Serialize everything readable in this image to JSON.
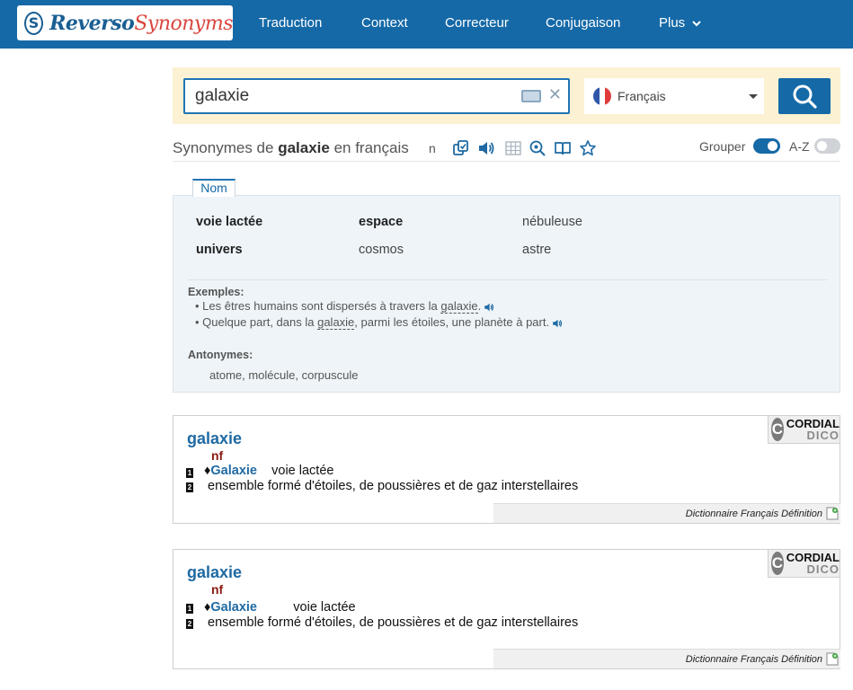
{
  "logo": {
    "badge": "S",
    "part1": "Reverso",
    "part2": "Synonyms"
  },
  "nav": [
    "Traduction",
    "Context",
    "Correcteur",
    "Conjugaison",
    "Plus"
  ],
  "search": {
    "value": "galaxie",
    "language": "Français"
  },
  "heading": {
    "prefix": "Synonymes de ",
    "word": "galaxie",
    "suffix": " en français",
    "n": "n"
  },
  "toolbar": {
    "grouper_label": "Grouper",
    "az_label": "A-Z",
    "grouper_on": true,
    "az_on": false
  },
  "nom": {
    "tab": "Nom",
    "synonyms": [
      [
        "voie lactée",
        "espace",
        "nébuleuse"
      ],
      [
        "univers",
        "cosmos",
        "astre"
      ]
    ],
    "examples_label": "Exemples:",
    "example1": {
      "before": "Les êtres humains sont dispersés à travers la ",
      "word": "galaxie",
      "after": "."
    },
    "example2": {
      "before": "Quelque part, dans la ",
      "word": "galaxie",
      "after": ", parmi les étoiles, une planète à part."
    },
    "antonyms_label": "Antonymes:",
    "antonyms": "atome, molécule, corpuscule"
  },
  "cards": [
    {
      "word": "galaxie",
      "pos": "nf",
      "def1_word": "Galaxie",
      "def1_text": "voie lactée",
      "def2": "ensemble formé d'étoiles, de poussières et de gaz interstellaires",
      "source": "Dictionnaire Français Définition",
      "logo_top": "CORDIAL",
      "logo_bottom": "DICO"
    },
    {
      "word": "galaxie",
      "pos": "nf",
      "def1_word": "Galaxie",
      "def1_text": "voie lactée",
      "def2": "ensemble formé d'étoiles, de poussières et de gaz interstellaires",
      "source": "Dictionnaire Français Définition",
      "logo_top": "CORDIAL",
      "logo_bottom": "DICO"
    }
  ],
  "colors": {
    "brand": "#1569a7",
    "logo_red": "#d9463f",
    "band": "#fdf1d3",
    "panel": "#eef4f8",
    "pos": "#8b1b12"
  }
}
